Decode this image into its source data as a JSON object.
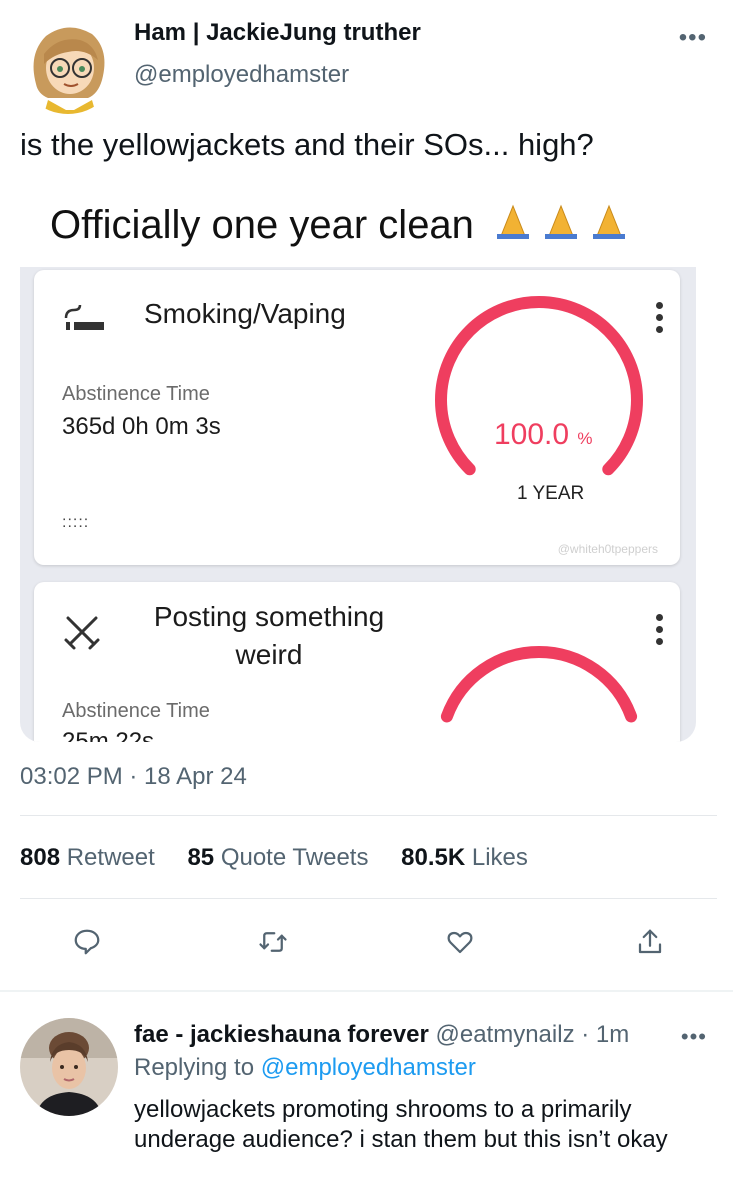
{
  "tweet": {
    "author_name": "Ham | JackieJung truther",
    "author_handle": "@employedhamster",
    "text": "is the yellowjackets and their SOs... high?",
    "more_icon": "more-horizontal-icon",
    "timestamp": "03:02 PM · 18 Apr 24"
  },
  "media": {
    "caption": "Officially one year clean",
    "caption_emoji": "🙏🙏🙏",
    "card1": {
      "icon": "smoking-icon",
      "title": "Smoking/Vaping",
      "abstinence_label": "Abstinence Time",
      "abstinence_value": "365d 0h 0m 3s",
      "dots": ":::::",
      "percent_value": "100.0",
      "percent_unit": "%",
      "progress_fraction": 1.0,
      "period_label": "1 YEAR",
      "watermark": "@whiteh0tpeppers"
    },
    "card2": {
      "icon": "crossed-swords-icon",
      "title_line1": "Posting something",
      "title_line2": "weird",
      "abstinence_label": "Abstinence Time",
      "abstinence_value": "25m 22s"
    },
    "gauge_color": "#ef3e5f"
  },
  "stats": {
    "retweets_count": "808",
    "retweets_label": "Retweet",
    "quotes_count": "85",
    "quotes_label": "Quote Tweets",
    "likes_count": "80.5K",
    "likes_label": "Likes"
  },
  "actions": [
    "reply-icon",
    "retweet-icon",
    "like-icon",
    "share-icon"
  ],
  "reply": {
    "author_name": "fae - jackieshauna forever",
    "author_handle": "@eatmynailz",
    "time": "· 1m",
    "replying_prefix": "Replying to",
    "replying_to": "@employedhamster",
    "text": "yellowjackets promoting shrooms to a primarily underage audience? i stan them but this isn’t okay"
  },
  "colors": {
    "link": "#1d9bf0",
    "secondary_text": "#536471",
    "primary_text": "#0f1419"
  }
}
